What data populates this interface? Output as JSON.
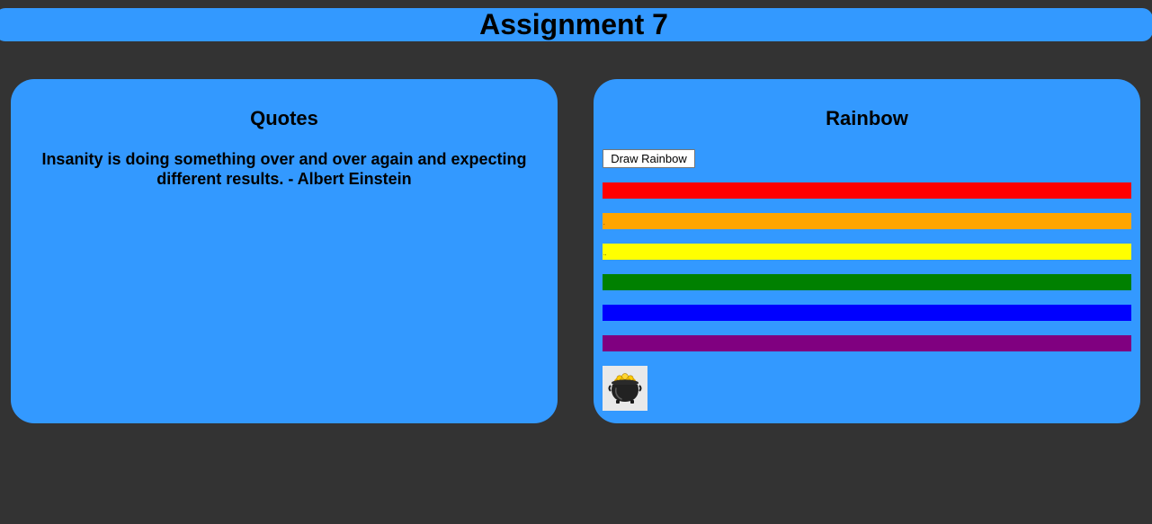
{
  "header": {
    "title": "Assignment 7"
  },
  "quotes_panel": {
    "title": "Quotes",
    "quote_text": "Insanity is doing something over and over again and expecting different results. - Albert Einstein"
  },
  "rainbow_panel": {
    "title": "Rainbow",
    "button_label": "Draw Rainbow",
    "stripes": [
      {
        "name": "red",
        "color": "#ff0000",
        "mark": ""
      },
      {
        "name": "orange",
        "color": "#ffa500",
        "mark": "."
      },
      {
        "name": "yellow",
        "color": "#ffff00",
        "mark": ".."
      },
      {
        "name": "green",
        "color": "#008000",
        "mark": ""
      },
      {
        "name": "blue",
        "color": "#0000ff",
        "mark": ""
      },
      {
        "name": "purple",
        "color": "#800080",
        "mark": ""
      }
    ],
    "pot_image": "pot-of-gold-icon"
  },
  "colors": {
    "background": "#333333",
    "accent": "#3399ff"
  }
}
